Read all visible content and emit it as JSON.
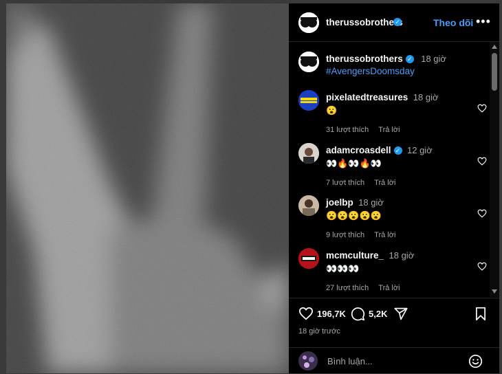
{
  "post": {
    "author": "therussobrothers",
    "follow_label": "Theo dõi",
    "more_label": "•••",
    "caption_author": "therussobrothers",
    "caption_time": "18 giờ",
    "caption_text": "#AvengersDoomsday"
  },
  "comments": [
    {
      "user": "pixelatedtreasures",
      "time": "18 giờ",
      "text": "😮",
      "likes": "31 lượt thích",
      "reply": "Trả lời",
      "verified": false
    },
    {
      "user": "adamcroasdell",
      "time": "12 giờ",
      "text": "👀🔥👀🔥👀",
      "likes": "7 lượt thích",
      "reply": "Trả lời",
      "verified": true
    },
    {
      "user": "joelbp",
      "time": "18 giờ",
      "text": "😮😮😮😮😮",
      "likes": "9 lượt thích",
      "reply": "Trả lời",
      "verified": false
    },
    {
      "user": "mcmculture_",
      "time": "18 giờ",
      "text": "👀👀👀",
      "likes": "27 lượt thích",
      "reply": "Trả lời",
      "verified": false
    }
  ],
  "actions": {
    "likes": "196,7K",
    "comments": "5,2K",
    "time_ago": "18 giờ trước"
  },
  "composer": {
    "placeholder": "Bình luận..."
  },
  "colors": {
    "background": "#000000",
    "accent": "#4a9df8",
    "verified": "#1d9bf0"
  }
}
